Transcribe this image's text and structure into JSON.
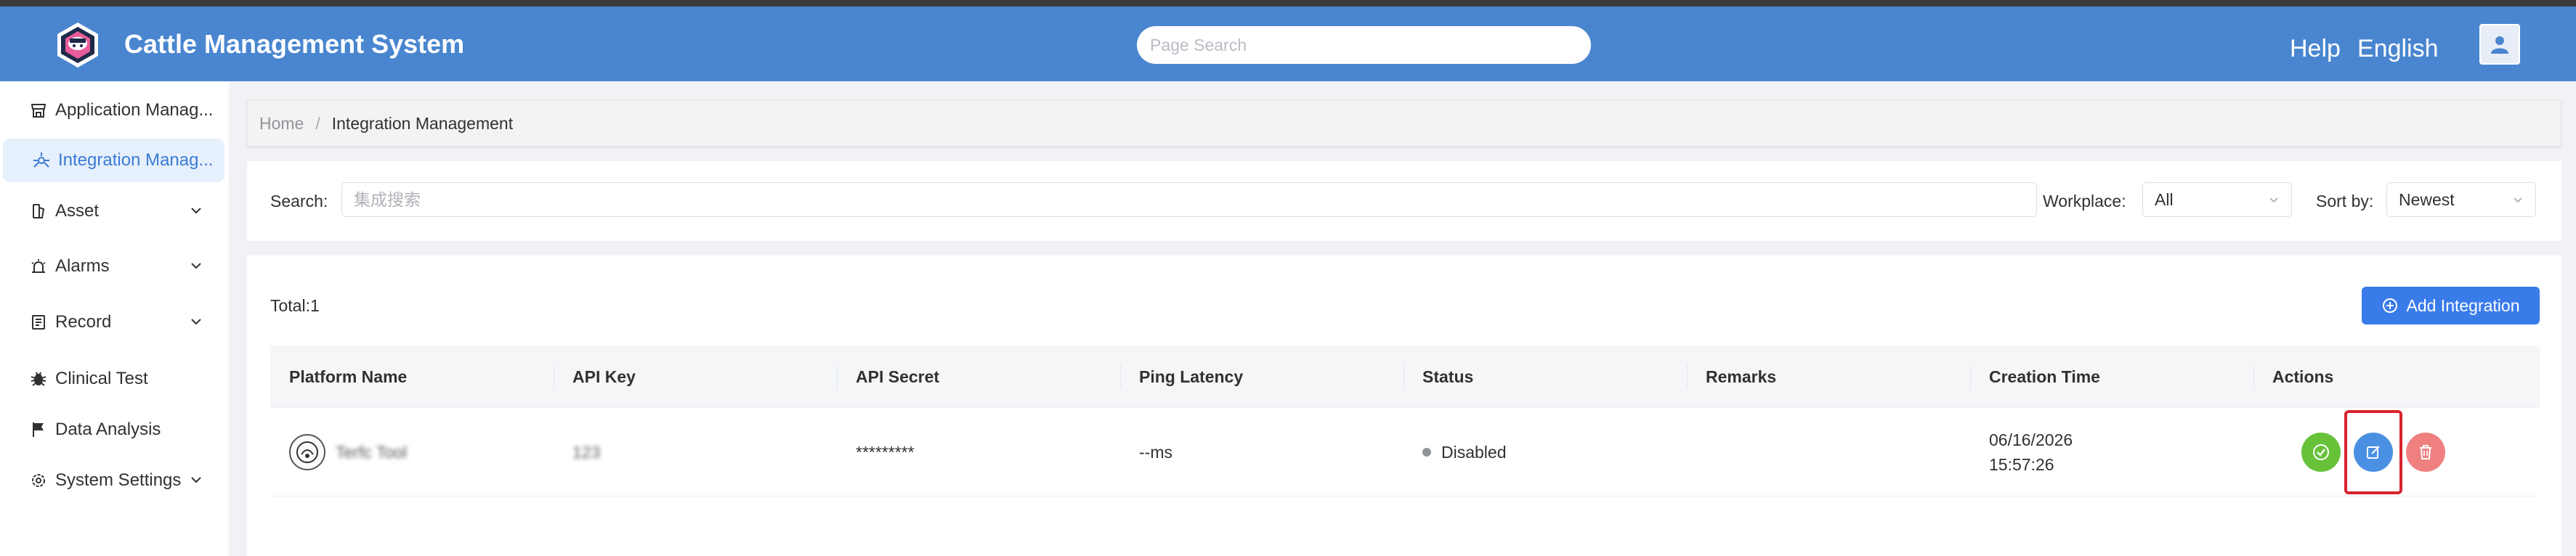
{
  "header": {
    "app_title": "Cattle Management System",
    "search_placeholder": "Page Search",
    "help_label": "Help",
    "language_label": "English",
    "brand_color": "#4a86d0"
  },
  "sidebar": {
    "items": [
      {
        "label": "Application Manag...",
        "icon": "store-icon",
        "expandable": false,
        "active": false
      },
      {
        "label": "Integration Manag...",
        "icon": "integration-icon",
        "expandable": false,
        "active": true
      },
      {
        "label": "Asset",
        "icon": "asset-icon",
        "expandable": true,
        "active": false
      },
      {
        "label": "Alarms",
        "icon": "alarm-icon",
        "expandable": true,
        "active": false
      },
      {
        "label": "Record",
        "icon": "record-icon",
        "expandable": true,
        "active": false
      },
      {
        "label": "Clinical Test",
        "icon": "bug-icon",
        "expandable": false,
        "active": false
      },
      {
        "label": "Data Analysis",
        "icon": "flag-icon",
        "expandable": false,
        "active": false
      },
      {
        "label": "System Settings",
        "icon": "gear-icon",
        "expandable": true,
        "active": false
      }
    ]
  },
  "breadcrumb": {
    "home": "Home",
    "separator": "/",
    "current": "Integration Management"
  },
  "filters": {
    "search_label": "Search:",
    "search_placeholder": "集成搜索",
    "workplace_label": "Workplace:",
    "workplace_value": "All",
    "sort_label": "Sort by:",
    "sort_value": "Newest"
  },
  "table": {
    "total_label": "Total:1",
    "add_button_label": "Add Integration",
    "columns": [
      "Platform Name",
      "API Key",
      "API Secret",
      "Ping Latency",
      "Status",
      "Remarks",
      "Creation Time",
      "Actions"
    ],
    "rows": [
      {
        "platform_name": "Terfc Tool",
        "api_key": "123",
        "api_secret": "*********",
        "ping_latency": "--ms",
        "status": "Disabled",
        "remarks": "",
        "creation_date": "06/16/2026",
        "creation_time": "15:57:26"
      }
    ]
  },
  "colors": {
    "accent": "#3a7bea",
    "enable": "#67c23a",
    "edit": "#4a90e2",
    "delete": "#f08080",
    "highlight": "#d9232b"
  }
}
